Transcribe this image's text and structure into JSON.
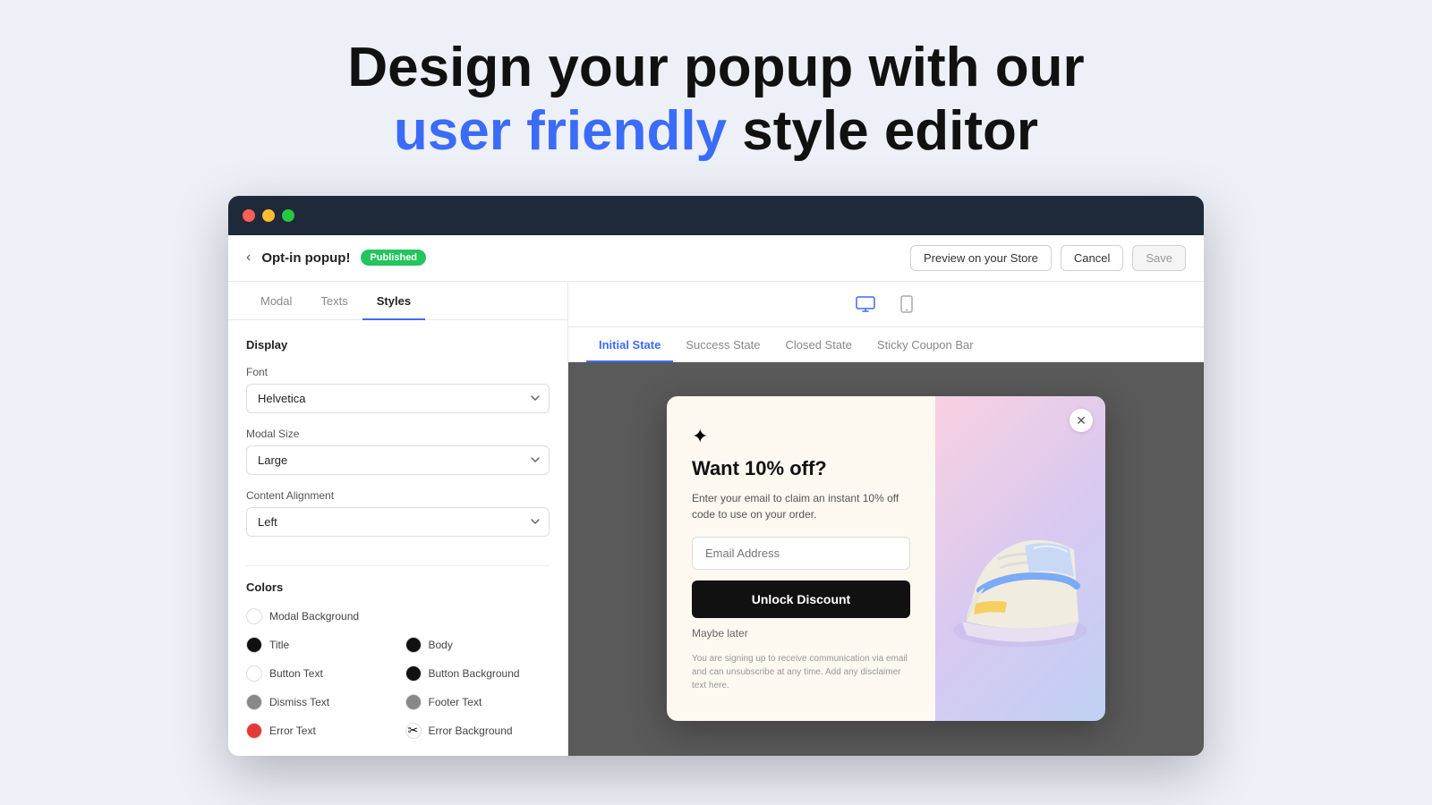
{
  "hero": {
    "line1": "Design your popup with our",
    "line2_blue": "user friendly",
    "line2_dark": " style editor"
  },
  "browser": {
    "dots": [
      "red",
      "yellow",
      "green"
    ]
  },
  "header": {
    "back_label": "‹",
    "title": "Opt-in popup!",
    "badge": "Published",
    "preview_label": "Preview on your Store",
    "cancel_label": "Cancel",
    "save_label": "Save"
  },
  "tabs": [
    {
      "label": "Modal",
      "active": false
    },
    {
      "label": "Texts",
      "active": false
    },
    {
      "label": "Styles",
      "active": true
    }
  ],
  "sidebar": {
    "display_section": "Display",
    "font_label": "Font",
    "font_value": "Helvetica",
    "modal_size_label": "Modal Size",
    "modal_size_value": "Large",
    "content_align_label": "Content Alignment",
    "content_align_value": "Left",
    "colors_section": "Colors",
    "color_items_left": [
      {
        "label": "Modal Background",
        "swatch": "white"
      },
      {
        "label": "Title",
        "swatch": "black"
      },
      {
        "label": "Button Text",
        "swatch": "white"
      },
      {
        "label": "Dismiss Text",
        "swatch": "gray"
      },
      {
        "label": "Error Text",
        "swatch": "red"
      }
    ],
    "color_items_right": [
      {
        "label": "Body",
        "swatch": "black"
      },
      {
        "label": "Button Background",
        "swatch": "black"
      },
      {
        "label": "Footer Text",
        "swatch": "gray"
      },
      {
        "label": "Error Background",
        "swatch": "scissors"
      }
    ]
  },
  "preview": {
    "device_desktop": "desktop",
    "device_mobile": "mobile",
    "state_tabs": [
      {
        "label": "Initial State",
        "active": true
      },
      {
        "label": "Success State",
        "active": false
      },
      {
        "label": "Closed State",
        "active": false
      },
      {
        "label": "Sticky Coupon Bar",
        "active": false
      }
    ]
  },
  "popup": {
    "icon": "✦",
    "heading": "Want 10% off?",
    "subtext": "Enter your email to claim an instant 10% off code to use on your order.",
    "email_placeholder": "Email Address",
    "cta_label": "Unlock Discount",
    "maybe_later": "Maybe later",
    "disclaimer": "You are signing up to receive communication via email and can unsubscribe at any time. Add any disclaimer text here."
  }
}
